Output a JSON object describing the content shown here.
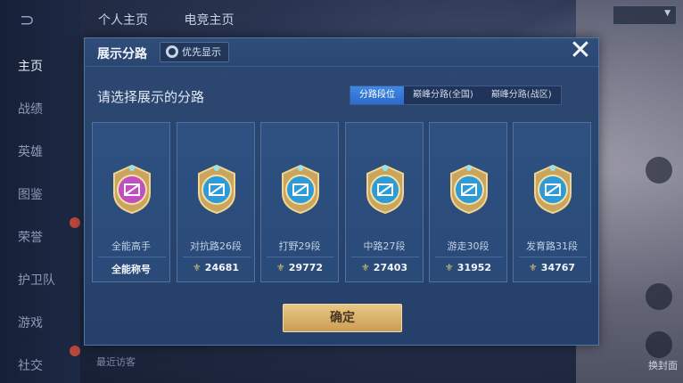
{
  "background": {
    "top_tabs": [
      "个人主页",
      "电竞主页"
    ],
    "nav_items": [
      "主页",
      "战绩",
      "英雄",
      "图鉴",
      "荣誉",
      "护卫队",
      "游戏",
      "社交"
    ],
    "recent_visitors": "最近访客",
    "side_label": "换封面"
  },
  "modal": {
    "title": "展示分路",
    "priority_label": "优先显示",
    "close_glyph": "✕",
    "subtitle": "请选择展示的分路",
    "tabs": [
      "分路段位",
      "巅峰分路(全国)",
      "巅峰分路(战区)"
    ],
    "active_tab_index": 0,
    "cards": [
      {
        "rank": "全能高手",
        "score": "全能称号",
        "has_coin": false,
        "icon": "all-around-badge-icon",
        "color": "#c14fc1"
      },
      {
        "rank": "对抗路26段",
        "score": "24681",
        "has_coin": true,
        "icon": "clash-lane-badge-icon",
        "color": "#2c9bd8"
      },
      {
        "rank": "打野29段",
        "score": "29772",
        "has_coin": true,
        "icon": "jungle-badge-icon",
        "color": "#2c9bd8"
      },
      {
        "rank": "中路27段",
        "score": "27403",
        "has_coin": true,
        "icon": "mid-lane-badge-icon",
        "color": "#2c9bd8"
      },
      {
        "rank": "游走30段",
        "score": "31952",
        "has_coin": true,
        "icon": "roam-badge-icon",
        "color": "#2c9bd8"
      },
      {
        "rank": "发育路31段",
        "score": "34767",
        "has_coin": true,
        "icon": "farm-lane-badge-icon",
        "color": "#2c9bd8"
      }
    ],
    "confirm_label": "确定"
  }
}
